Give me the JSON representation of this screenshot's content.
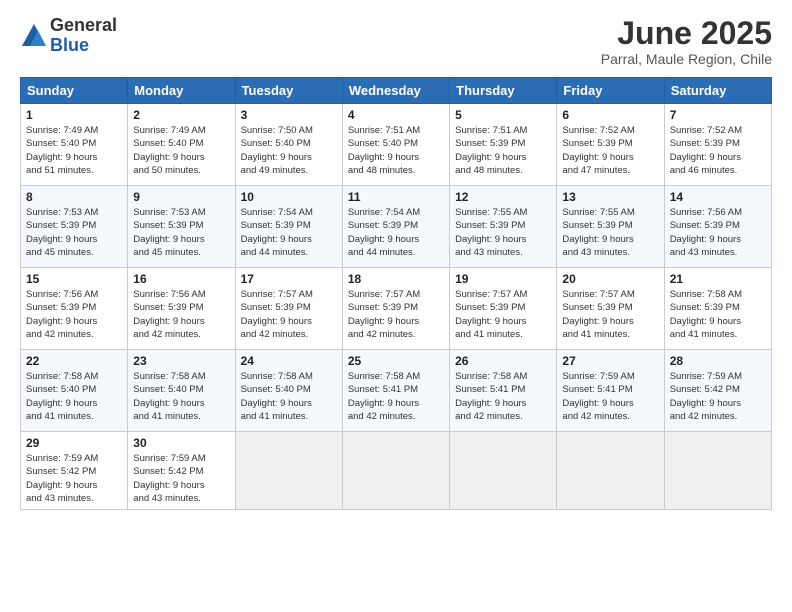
{
  "logo": {
    "general": "General",
    "blue": "Blue"
  },
  "title": {
    "month_year": "June 2025",
    "location": "Parral, Maule Region, Chile"
  },
  "days_of_week": [
    "Sunday",
    "Monday",
    "Tuesday",
    "Wednesday",
    "Thursday",
    "Friday",
    "Saturday"
  ],
  "weeks": [
    [
      {
        "day": "1",
        "sunrise": "7:49 AM",
        "sunset": "5:40 PM",
        "daylight_h": "9",
        "daylight_m": "51"
      },
      {
        "day": "2",
        "sunrise": "7:49 AM",
        "sunset": "5:40 PM",
        "daylight_h": "9",
        "daylight_m": "50"
      },
      {
        "day": "3",
        "sunrise": "7:50 AM",
        "sunset": "5:40 PM",
        "daylight_h": "9",
        "daylight_m": "49"
      },
      {
        "day": "4",
        "sunrise": "7:51 AM",
        "sunset": "5:40 PM",
        "daylight_h": "9",
        "daylight_m": "48"
      },
      {
        "day": "5",
        "sunrise": "7:51 AM",
        "sunset": "5:39 PM",
        "daylight_h": "9",
        "daylight_m": "48"
      },
      {
        "day": "6",
        "sunrise": "7:52 AM",
        "sunset": "5:39 PM",
        "daylight_h": "9",
        "daylight_m": "47"
      },
      {
        "day": "7",
        "sunrise": "7:52 AM",
        "sunset": "5:39 PM",
        "daylight_h": "9",
        "daylight_m": "46"
      }
    ],
    [
      {
        "day": "8",
        "sunrise": "7:53 AM",
        "sunset": "5:39 PM",
        "daylight_h": "9",
        "daylight_m": "45"
      },
      {
        "day": "9",
        "sunrise": "7:53 AM",
        "sunset": "5:39 PM",
        "daylight_h": "9",
        "daylight_m": "45"
      },
      {
        "day": "10",
        "sunrise": "7:54 AM",
        "sunset": "5:39 PM",
        "daylight_h": "9",
        "daylight_m": "44"
      },
      {
        "day": "11",
        "sunrise": "7:54 AM",
        "sunset": "5:39 PM",
        "daylight_h": "9",
        "daylight_m": "44"
      },
      {
        "day": "12",
        "sunrise": "7:55 AM",
        "sunset": "5:39 PM",
        "daylight_h": "9",
        "daylight_m": "43"
      },
      {
        "day": "13",
        "sunrise": "7:55 AM",
        "sunset": "5:39 PM",
        "daylight_h": "9",
        "daylight_m": "43"
      },
      {
        "day": "14",
        "sunrise": "7:56 AM",
        "sunset": "5:39 PM",
        "daylight_h": "9",
        "daylight_m": "43"
      }
    ],
    [
      {
        "day": "15",
        "sunrise": "7:56 AM",
        "sunset": "5:39 PM",
        "daylight_h": "9",
        "daylight_m": "42"
      },
      {
        "day": "16",
        "sunrise": "7:56 AM",
        "sunset": "5:39 PM",
        "daylight_h": "9",
        "daylight_m": "42"
      },
      {
        "day": "17",
        "sunrise": "7:57 AM",
        "sunset": "5:39 PM",
        "daylight_h": "9",
        "daylight_m": "42"
      },
      {
        "day": "18",
        "sunrise": "7:57 AM",
        "sunset": "5:39 PM",
        "daylight_h": "9",
        "daylight_m": "42"
      },
      {
        "day": "19",
        "sunrise": "7:57 AM",
        "sunset": "5:39 PM",
        "daylight_h": "9",
        "daylight_m": "41"
      },
      {
        "day": "20",
        "sunrise": "7:57 AM",
        "sunset": "5:39 PM",
        "daylight_h": "9",
        "daylight_m": "41"
      },
      {
        "day": "21",
        "sunrise": "7:58 AM",
        "sunset": "5:39 PM",
        "daylight_h": "9",
        "daylight_m": "41"
      }
    ],
    [
      {
        "day": "22",
        "sunrise": "7:58 AM",
        "sunset": "5:40 PM",
        "daylight_h": "9",
        "daylight_m": "41"
      },
      {
        "day": "23",
        "sunrise": "7:58 AM",
        "sunset": "5:40 PM",
        "daylight_h": "9",
        "daylight_m": "41"
      },
      {
        "day": "24",
        "sunrise": "7:58 AM",
        "sunset": "5:40 PM",
        "daylight_h": "9",
        "daylight_m": "41"
      },
      {
        "day": "25",
        "sunrise": "7:58 AM",
        "sunset": "5:41 PM",
        "daylight_h": "9",
        "daylight_m": "42"
      },
      {
        "day": "26",
        "sunrise": "7:58 AM",
        "sunset": "5:41 PM",
        "daylight_h": "9",
        "daylight_m": "42"
      },
      {
        "day": "27",
        "sunrise": "7:59 AM",
        "sunset": "5:41 PM",
        "daylight_h": "9",
        "daylight_m": "42"
      },
      {
        "day": "28",
        "sunrise": "7:59 AM",
        "sunset": "5:42 PM",
        "daylight_h": "9",
        "daylight_m": "42"
      }
    ],
    [
      {
        "day": "29",
        "sunrise": "7:59 AM",
        "sunset": "5:42 PM",
        "daylight_h": "9",
        "daylight_m": "43"
      },
      {
        "day": "30",
        "sunrise": "7:59 AM",
        "sunset": "5:42 PM",
        "daylight_h": "9",
        "daylight_m": "43"
      },
      null,
      null,
      null,
      null,
      null
    ]
  ]
}
